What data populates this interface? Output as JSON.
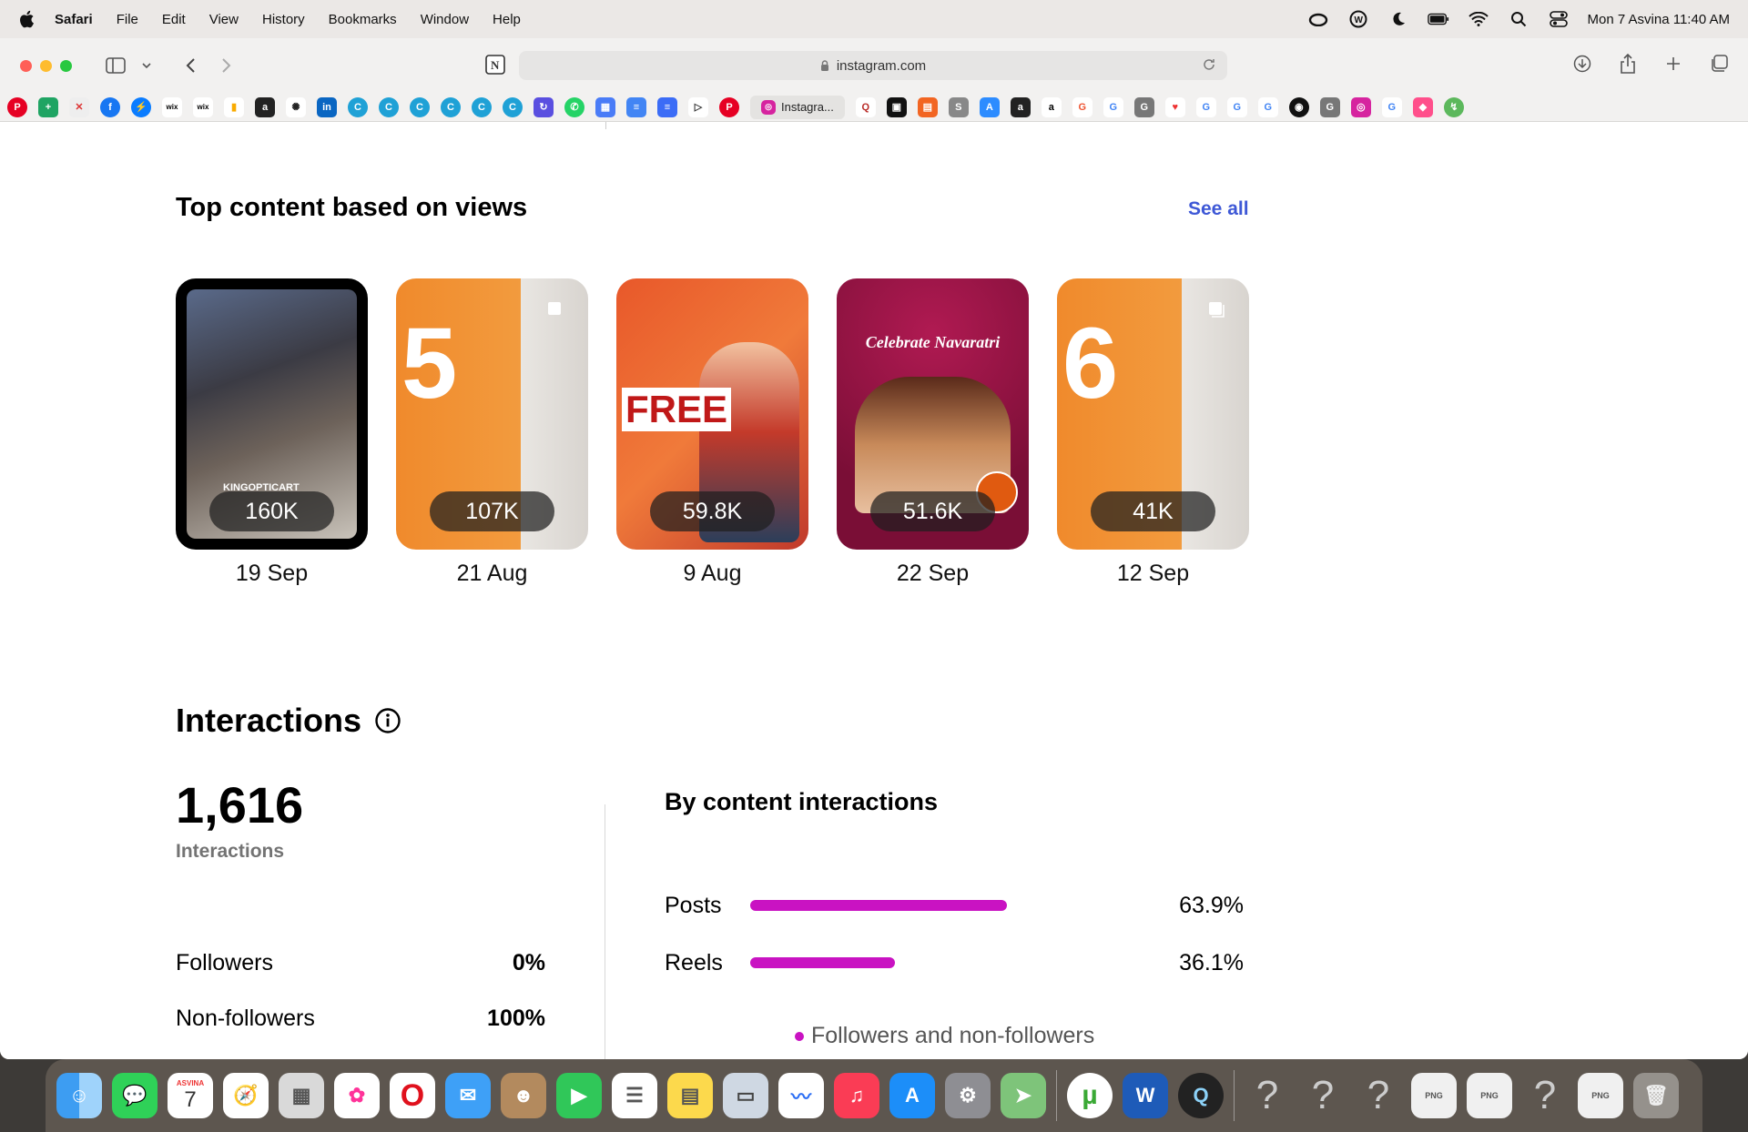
{
  "menubar": {
    "app_name": "Safari",
    "items": [
      "File",
      "Edit",
      "View",
      "History",
      "Bookmarks",
      "Window",
      "Help"
    ],
    "clock": "Mon 7 Asvina  11:40 AM"
  },
  "browser": {
    "url": "instagram.com",
    "active_tab_label": "Instagra..."
  },
  "top_content": {
    "title": "Top content based on views",
    "see_all": "See all",
    "items": [
      {
        "views": "160K",
        "date": "19 Sep",
        "overlay": "KINGOPTICART",
        "bg": "#2b2a2a"
      },
      {
        "views": "107K",
        "date": "21 Aug",
        "overlay": "5",
        "bg": "#f08a2c"
      },
      {
        "views": "59.8K",
        "date": "9 Aug",
        "overlay": "FREE",
        "bg": "#e8582a"
      },
      {
        "views": "51.6K",
        "date": "22 Sep",
        "overlay": "Celebrate Navaratri",
        "bg": "#8a1240"
      },
      {
        "views": "41K",
        "date": "12 Sep",
        "overlay": "6",
        "bg": "#f08a2c"
      }
    ]
  },
  "interactions": {
    "title": "Interactions",
    "total": "1,616",
    "total_label": "Interactions",
    "split": [
      {
        "label": "Followers",
        "value": "0%"
      },
      {
        "label": "Non-followers",
        "value": "100%"
      }
    ],
    "by_content_title": "By content interactions",
    "by_content": [
      {
        "label": "Posts",
        "value": "63.9%",
        "fraction": 0.639
      },
      {
        "label": "Reels",
        "value": "36.1%",
        "fraction": 0.361
      }
    ],
    "legend": "Followers and non-followers",
    "accent": "#c913c2"
  },
  "dock": {
    "calendar_month": "ASVINA",
    "calendar_day": "7"
  }
}
